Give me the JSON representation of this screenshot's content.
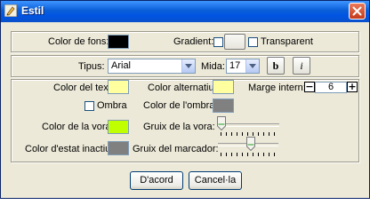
{
  "window": {
    "title": "Estil",
    "app_icon": "pencil-icon",
    "close_icon": "close-icon"
  },
  "background": {
    "color_label": "Color de fons:",
    "color_value": "#000000",
    "gradient_label": "Gradient:",
    "gradient_checked": false,
    "transparent_label": "Transparent",
    "transparent_checked": false
  },
  "font": {
    "type_label": "Tipus:",
    "type_value": "Arial",
    "size_label": "Mida:",
    "size_value": "17",
    "bold_label": "b",
    "italic_label": "i"
  },
  "style": {
    "text_color_label": "Color del text:",
    "text_color_value": "#ffffa0",
    "alt_color_label": "Color alternatiu:",
    "alt_color_value": "#ffffa0",
    "margin_label": "Marge intern:",
    "margin_value": "6",
    "minus_label": "−",
    "plus_label": "+",
    "shadow_label": "Ombra",
    "shadow_checked": false,
    "shadow_color_label": "Color de l'ombra:",
    "shadow_color_value": "#808080",
    "border_color_label": "Color de la vora:",
    "border_color_value": "#c0ff00",
    "border_width_label": "Gruix de la vora:",
    "border_width_level": 0.0,
    "inactive_color_label": "Color d'estat inactiu:",
    "inactive_color_value": "#808080",
    "marker_width_label": "Gruix del marcador:",
    "marker_width_level": 0.4
  },
  "buttons": {
    "ok": "D'acord",
    "cancel": "Cancel·la"
  }
}
